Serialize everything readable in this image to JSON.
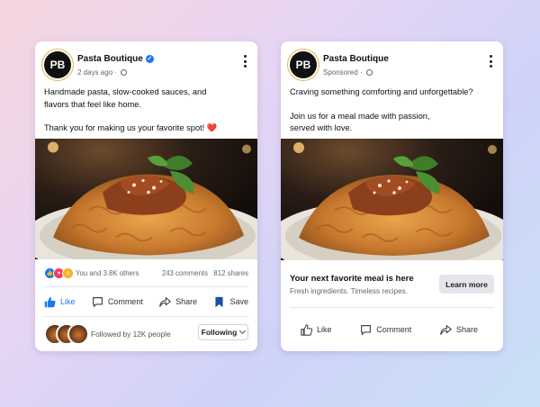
{
  "left_card": {
    "avatar_initials": "PB",
    "page_name": "Pasta Boutique",
    "timestamp": "2 days ago",
    "text_line1": "Handmade pasta, slow-cooked sauces, and",
    "text_line2": "flavors that feel like home.",
    "text_line3": "Thank you for making us your favorite spot!",
    "heart": "❤️",
    "reactions_text": "You and 3.8K others",
    "comments": "243 comments",
    "shares": "812 shares",
    "actions": {
      "like": "Like",
      "comment": "Comment",
      "share": "Share",
      "save": "Save"
    },
    "followed_by": "Followed by 12K people",
    "following_button": "Following"
  },
  "right_card": {
    "avatar_initials": "PB",
    "page_name": "Pasta Boutique",
    "sponsored": "Sponsored",
    "text_line1": "Craving something comforting and unforgettable?",
    "text_line2": "Join us for a meal made with passion,",
    "text_line3": "served with love.",
    "cta_title": "Your next favorite meal is here",
    "cta_subtitle": "Fresh ingredients. Timeless recipes.",
    "cta_button": "Learn more",
    "actions": {
      "like": "Like",
      "comment": "Comment",
      "share": "Share"
    }
  },
  "colors": {
    "brand_blue": "#1877f2",
    "love_red": "#f33e58",
    "wow_yellow": "#f7b125",
    "muted_text": "#65676b"
  }
}
